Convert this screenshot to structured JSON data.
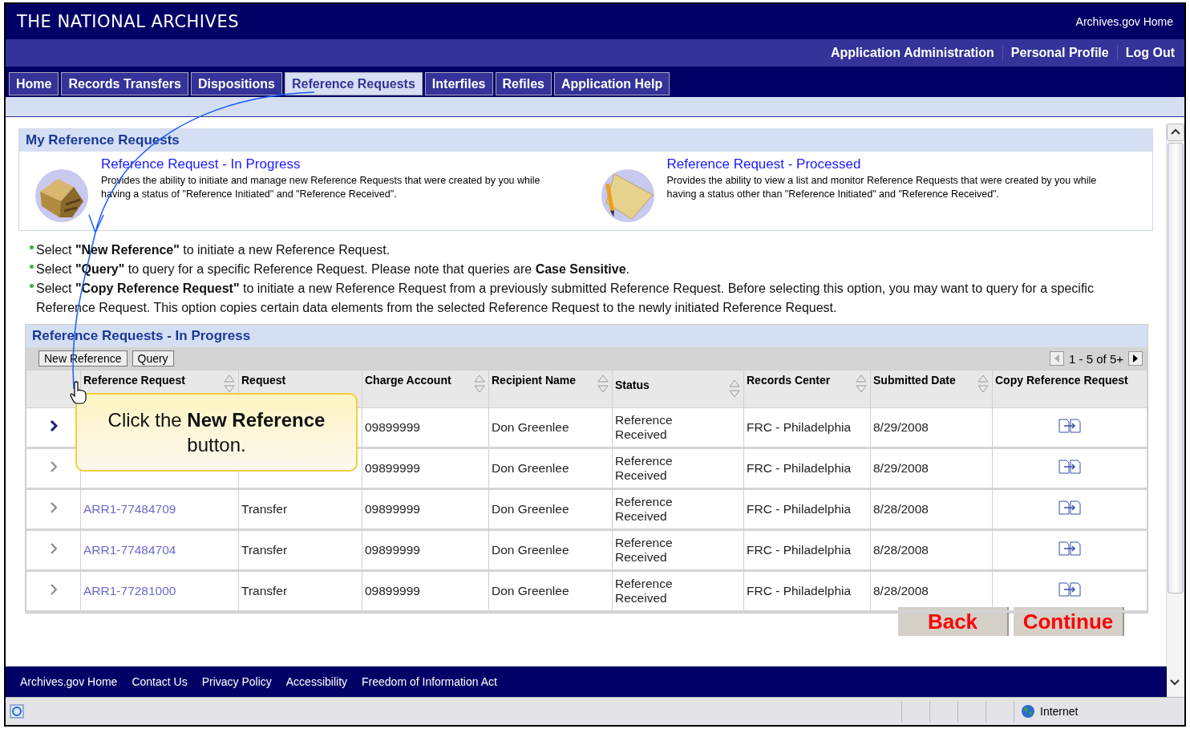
{
  "header": {
    "title": "THE NATIONAL ARCHIVES",
    "home_link": "Archives.gov Home"
  },
  "top_links": [
    "Application Administration",
    "Personal Profile",
    "Log Out"
  ],
  "tabs": [
    {
      "label": "Home",
      "selected": false
    },
    {
      "label": "Records Transfers",
      "selected": false
    },
    {
      "label": "Dispositions",
      "selected": false
    },
    {
      "label": "Reference Requests",
      "selected": true
    },
    {
      "label": "Interfiles",
      "selected": false
    },
    {
      "label": "Refiles",
      "selected": false
    },
    {
      "label": "Application Help",
      "selected": false
    }
  ],
  "my_requests": {
    "title": "My Reference Requests",
    "cards": [
      {
        "kind": "box",
        "title": "Reference Request - In Progress",
        "description": "Provides the ability to initiate and manage new Reference Requests that were created by you while having a status of \"Reference Initiated\" and \"Reference Received\"."
      },
      {
        "kind": "notepad",
        "title": "Reference Request - Processed",
        "description": "Provides the ability to view a list and monitor Reference Requests that were created by you while having a status other than \"Reference Initiated\" and \"Reference Received\"."
      }
    ]
  },
  "instructions": [
    "Select **\"New Reference\"** to initiate a new Reference Request.",
    "Select **\"Query\"** to query for a specific Reference Request. Please note that queries are **Case Sensitive**.",
    "Select **\"Copy Reference Request\"** to initiate a new Reference Request from a previously submitted Reference Request. Before selecting this option, you may want to query for a specific Reference Request. This option copies certain data elements from the selected Reference Request to the newly initiated Reference Request."
  ],
  "in_progress": {
    "title": "Reference Requests - In Progress",
    "buttons": [
      "New Reference",
      "Query"
    ],
    "pagination": "1 - 5 of 5+",
    "columns": [
      {
        "label": "Reference Request",
        "sortable": true
      },
      {
        "label": "Request",
        "sortable": false
      },
      {
        "label": "Charge Account",
        "sortable": true
      },
      {
        "label": "Recipient Name",
        "sortable": true
      },
      {
        "label": "Status",
        "sortable": true
      },
      {
        "label": "Records Center",
        "sortable": true
      },
      {
        "label": "Submitted Date",
        "sortable": true
      },
      {
        "label": "Copy Reference Request",
        "sortable": false
      }
    ],
    "rows": [
      {
        "selected": true,
        "charge_account": "09899999",
        "recipient": "Don Greenlee",
        "status": "Reference Received",
        "records_center": "FRC - Philadelphia",
        "date": "8/29/2008"
      },
      {
        "selected": false,
        "charge_account": "09899999",
        "recipient": "Don Greenlee",
        "status": "Reference Received",
        "records_center": "FRC - Philadelphia",
        "date": "8/29/2008"
      },
      {
        "selected": false,
        "reference": "ARR1-77484709",
        "request": "Transfer",
        "charge_account": "09899999",
        "recipient": "Don Greenlee",
        "status": "Reference Received",
        "records_center": "FRC - Philadelphia",
        "date": "8/28/2008"
      },
      {
        "selected": false,
        "reference": "ARR1-77484704",
        "request": "Transfer",
        "charge_account": "09899999",
        "recipient": "Don Greenlee",
        "status": "Reference Received",
        "records_center": "FRC - Philadelphia",
        "date": "8/28/2008"
      },
      {
        "selected": false,
        "reference": "ARR1-77281000",
        "request": "Transfer",
        "charge_account": "09899999",
        "recipient": "Don Greenlee",
        "status": "Reference Received",
        "records_center": "FRC - Philadelphia",
        "date": "8/28/2008"
      }
    ]
  },
  "callout": "Click the **New Reference** button.",
  "nav_buttons": [
    "Back",
    "Continue"
  ],
  "footer_links": [
    "Archives.gov Home",
    "Contact Us",
    "Privacy Policy",
    "Accessibility",
    "Freedom of Information Act"
  ],
  "status_bar": {
    "zone": "Internet"
  }
}
